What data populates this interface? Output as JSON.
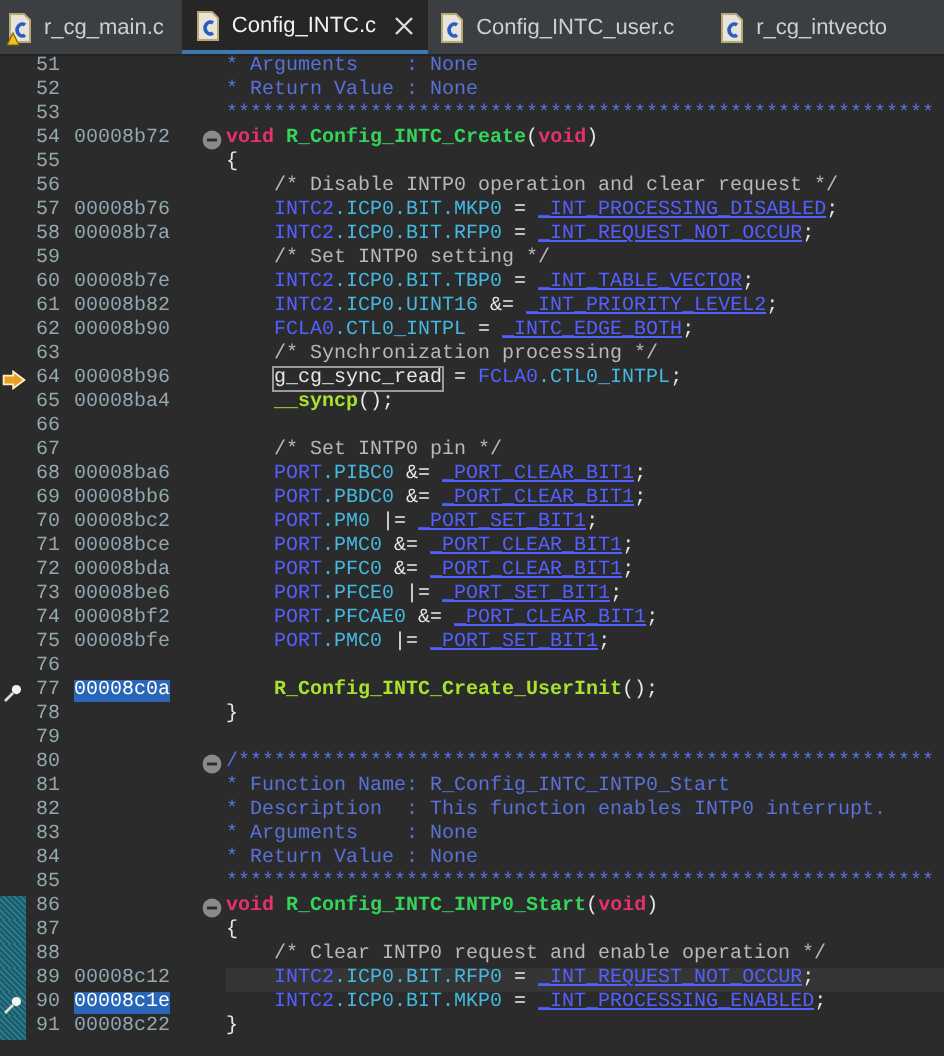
{
  "tabs": [
    {
      "label": "r_cg_main.c",
      "selected": false,
      "warning": true,
      "closable": false
    },
    {
      "label": "Config_INTC.c",
      "selected": true,
      "warning": false,
      "closable": true
    },
    {
      "label": "Config_INTC_user.c",
      "selected": false,
      "warning": false,
      "closable": false
    },
    {
      "label": "r_cg_intvecto",
      "selected": false,
      "warning": false,
      "closable": false
    }
  ],
  "lines": [
    {
      "number": "51",
      "segments": [
        {
          "kind": "doc",
          "text": "* Arguments    : None"
        }
      ]
    },
    {
      "number": "52",
      "segments": [
        {
          "kind": "doc",
          "text": "* Return Value : None"
        }
      ]
    },
    {
      "number": "53",
      "segments": [
        {
          "kind": "doc",
          "text": "***********************************************************"
        }
      ]
    },
    {
      "number": "54",
      "address": "00008b72",
      "fold": true,
      "segments": [
        {
          "kind": "keyword",
          "text": "void"
        },
        {
          "kind": "fn",
          "text": "R_Config_INTC_Create"
        },
        {
          "kind": "plain",
          "text": "("
        },
        {
          "kind": "keyword",
          "text": "void"
        },
        {
          "kind": "plain",
          "text": ")"
        }
      ]
    },
    {
      "number": "55",
      "segments": [
        {
          "kind": "plain",
          "text": "{"
        }
      ],
      "children": [
        {
          "number": "56",
          "segments": [
            {
              "kind": "comment",
              "text": "/* Disable INTP0 operation and clear request */"
            }
          ]
        },
        {
          "number": "57",
          "address": "00008b76",
          "segments": [
            {
              "kind": "reg",
              "text": "INTC2"
            },
            {
              "kind": "member",
              "text": ".ICP0.BIT.MKP0"
            },
            {
              "kind": "plain",
              "text": " = "
            },
            {
              "kind": "const",
              "text": "_INT_PROCESSING_DISABLED"
            },
            {
              "kind": "plain",
              "text": ";"
            }
          ]
        },
        {
          "number": "58",
          "address": "00008b7a",
          "segments": [
            {
              "kind": "reg",
              "text": "INTC2"
            },
            {
              "kind": "member",
              "text": ".ICP0.BIT.RFP0"
            },
            {
              "kind": "plain",
              "text": " = "
            },
            {
              "kind": "const",
              "text": "_INT_REQUEST_NOT_OCCUR"
            },
            {
              "kind": "plain",
              "text": ";"
            }
          ]
        },
        {
          "number": "59",
          "segments": [
            {
              "kind": "comment",
              "text": "/* Set INTP0 setting */"
            }
          ]
        },
        {
          "number": "60",
          "address": "00008b7e",
          "segments": [
            {
              "kind": "reg",
              "text": "INTC2"
            },
            {
              "kind": "member",
              "text": ".ICP0.BIT.TBP0"
            },
            {
              "kind": "plain",
              "text": " = "
            },
            {
              "kind": "const",
              "text": "_INT_TABLE_VECTOR"
            },
            {
              "kind": "plain",
              "text": ";"
            }
          ]
        },
        {
          "number": "61",
          "address": "00008b82",
          "segments": [
            {
              "kind": "reg",
              "text": "INTC2"
            },
            {
              "kind": "member",
              "text": ".ICP0.UINT16"
            },
            {
              "kind": "plain",
              "text": " &= "
            },
            {
              "kind": "const",
              "text": "_INT_PRIORITY_LEVEL2"
            },
            {
              "kind": "plain",
              "text": ";"
            }
          ]
        },
        {
          "number": "62",
          "address": "00008b90",
          "segments": [
            {
              "kind": "reg",
              "text": "FCLA0"
            },
            {
              "kind": "member",
              "text": ".CTL0_INTPL"
            },
            {
              "kind": "plain",
              "text": " = "
            },
            {
              "kind": "const",
              "text": "_INTC_EDGE_BOTH"
            },
            {
              "kind": "plain",
              "text": ";"
            }
          ]
        },
        {
          "number": "63",
          "segments": [
            {
              "kind": "comment",
              "text": "/* Synchronization processing */"
            }
          ]
        },
        {
          "number": "64",
          "address": "00008b96",
          "current_pc": true,
          "segments": [
            {
              "kind": "plain",
              "text": "g_cg_sync_read",
              "hovered": true
            },
            {
              "kind": "plain",
              "text": " = "
            },
            {
              "kind": "reg",
              "text": "FCLA0"
            },
            {
              "kind": "member",
              "text": ".CTL0_INTPL"
            },
            {
              "kind": "plain",
              "text": ";"
            }
          ]
        },
        {
          "number": "65",
          "address": "00008ba4",
          "segments": [
            {
              "kind": "call",
              "text": "__syncp"
            },
            {
              "kind": "plain",
              "text": "();"
            }
          ]
        },
        {
          "number": "66"
        },
        {
          "number": "67",
          "segments": [
            {
              "kind": "comment",
              "text": "/* Set INTP0 pin */"
            }
          ]
        },
        {
          "number": "68",
          "address": "00008ba6",
          "segments": [
            {
              "kind": "reg",
              "text": "PORT"
            },
            {
              "kind": "member",
              "text": ".PIBC0"
            },
            {
              "kind": "plain",
              "text": " &= "
            },
            {
              "kind": "const",
              "text": "_PORT_CLEAR_BIT1"
            },
            {
              "kind": "plain",
              "text": ";"
            }
          ]
        },
        {
          "number": "69",
          "address": "00008bb6",
          "segments": [
            {
              "kind": "reg",
              "text": "PORT"
            },
            {
              "kind": "member",
              "text": ".PBDC0"
            },
            {
              "kind": "plain",
              "text": " &= "
            },
            {
              "kind": "const",
              "text": "_PORT_CLEAR_BIT1"
            },
            {
              "kind": "plain",
              "text": ";"
            }
          ]
        },
        {
          "number": "70",
          "address": "00008bc2",
          "segments": [
            {
              "kind": "reg",
              "text": "PORT"
            },
            {
              "kind": "member",
              "text": ".PM0"
            },
            {
              "kind": "plain",
              "text": " |= "
            },
            {
              "kind": "const",
              "text": "_PORT_SET_BIT1"
            },
            {
              "kind": "plain",
              "text": ";"
            }
          ]
        },
        {
          "number": "71",
          "address": "00008bce",
          "segments": [
            {
              "kind": "reg",
              "text": "PORT"
            },
            {
              "kind": "member",
              "text": ".PMC0"
            },
            {
              "kind": "plain",
              "text": " &= "
            },
            {
              "kind": "const",
              "text": "_PORT_CLEAR_BIT1"
            },
            {
              "kind": "plain",
              "text": ";"
            }
          ]
        },
        {
          "number": "72",
          "address": "00008bda",
          "segments": [
            {
              "kind": "reg",
              "text": "PORT"
            },
            {
              "kind": "member",
              "text": ".PFC0"
            },
            {
              "kind": "plain",
              "text": " &= "
            },
            {
              "kind": "const",
              "text": "_PORT_CLEAR_BIT1"
            },
            {
              "kind": "plain",
              "text": ";"
            }
          ]
        },
        {
          "number": "73",
          "address": "00008be6",
          "segments": [
            {
              "kind": "reg",
              "text": "PORT"
            },
            {
              "kind": "member",
              "text": ".PFCE0"
            },
            {
              "kind": "plain",
              "text": " |= "
            },
            {
              "kind": "const",
              "text": "_PORT_SET_BIT1"
            },
            {
              "kind": "plain",
              "text": ";"
            }
          ]
        },
        {
          "number": "74",
          "address": "00008bf2",
          "segments": [
            {
              "kind": "reg",
              "text": "PORT"
            },
            {
              "kind": "member",
              "text": ".PFCAE0"
            },
            {
              "kind": "plain",
              "text": " &= "
            },
            {
              "kind": "const",
              "text": "_PORT_CLEAR_BIT1"
            },
            {
              "kind": "plain",
              "text": ";"
            }
          ]
        },
        {
          "number": "75",
          "address": "00008bfe",
          "segments": [
            {
              "kind": "reg",
              "text": "PORT"
            },
            {
              "kind": "member",
              "text": ".PMC0"
            },
            {
              "kind": "plain",
              "text": " |= "
            },
            {
              "kind": "const",
              "text": "_PORT_SET_BIT1"
            },
            {
              "kind": "plain",
              "text": ";"
            }
          ]
        },
        {
          "number": "76"
        },
        {
          "number": "77",
          "address": "00008c0a",
          "address_selected": true,
          "probe": true,
          "segments": [
            {
              "kind": "call",
              "text": "R_Config_INTC_Create_UserInit"
            },
            {
              "kind": "plain",
              "text": "();"
            }
          ]
        }
      ]
    },
    {
      "number": "78",
      "segments": [
        {
          "kind": "plain",
          "text": "}"
        }
      ]
    },
    {
      "number": "79"
    },
    {
      "number": "80",
      "fold": true,
      "segments": [
        {
          "kind": "doc",
          "text": "/**********************************************************"
        }
      ]
    },
    {
      "number": "81",
      "segments": [
        {
          "kind": "doc",
          "text": "* Function Name: R_Config_INTC_INTP0_Start"
        }
      ]
    },
    {
      "number": "82",
      "segments": [
        {
          "kind": "doc",
          "text": "* Description  : This function enables INTP0 interrupt."
        }
      ]
    },
    {
      "number": "83",
      "segments": [
        {
          "kind": "doc",
          "text": "* Arguments    : None"
        }
      ]
    },
    {
      "number": "84",
      "segments": [
        {
          "kind": "doc",
          "text": "* Return Value : None"
        }
      ]
    },
    {
      "number": "85",
      "segments": [
        {
          "kind": "doc",
          "text": "***********************************************************"
        }
      ]
    },
    {
      "number": "86",
      "fold": true,
      "covered": true,
      "segments": [
        {
          "kind": "keyword",
          "text": "void"
        },
        {
          "kind": "fn",
          "text": "R_Config_INTC_INTP0_Start"
        },
        {
          "kind": "plain",
          "text": "("
        },
        {
          "kind": "keyword",
          "text": "void"
        },
        {
          "kind": "plain",
          "text": ")"
        }
      ]
    },
    {
      "number": "87",
      "covered": true,
      "segments": [
        {
          "kind": "plain",
          "text": "{"
        }
      ],
      "children": [
        {
          "number": "88",
          "covered": true,
          "segments": [
            {
              "kind": "comment",
              "text": "/* Clear INTP0 request and enable operation */"
            }
          ]
        },
        {
          "number": "89",
          "address": "00008c12",
          "covered": true,
          "current": true,
          "segments": [
            {
              "kind": "reg",
              "text": "INTC2"
            },
            {
              "kind": "member",
              "text": ".ICP0.BIT.RFP0"
            },
            {
              "kind": "plain",
              "text": " = "
            },
            {
              "kind": "const",
              "text": "_INT_REQUEST_NOT_OCCUR"
            },
            {
              "kind": "plain",
              "text": ";"
            }
          ]
        },
        {
          "number": "90",
          "address": "00008c1e",
          "address_selected": true,
          "probe": true,
          "covered": true,
          "segments": [
            {
              "kind": "reg",
              "text": "INTC2"
            },
            {
              "kind": "member",
              "text": ".ICP0.BIT.MKP0"
            },
            {
              "kind": "plain",
              "text": " = "
            },
            {
              "kind": "const",
              "text": "_INT_PROCESSING_ENABLED"
            },
            {
              "kind": "plain",
              "text": ";"
            }
          ]
        }
      ]
    },
    {
      "number": "91",
      "address": "00008c22",
      "covered": true,
      "segments": [
        {
          "kind": "plain",
          "text": "}"
        }
      ]
    }
  ]
}
